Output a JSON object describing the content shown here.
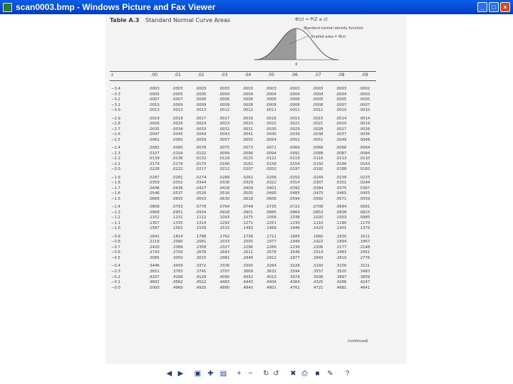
{
  "window": {
    "title": "scan0003.bmp - Windows Picture and Fax Viewer"
  },
  "table": {
    "number": "Table A.3",
    "caption": "Standard Normal Curve Areas",
    "formula": "Φ(z) = P(Z ≤ z)",
    "legend_density": "Standard normal density function",
    "legend_shaded": "Shaded area = Φ(z)",
    "axis_zero": "0",
    "header_z": "z",
    "columns": [
      ".00",
      ".01",
      ".02",
      ".03",
      ".04",
      ".05",
      ".06",
      ".07",
      ".08",
      ".09"
    ],
    "continued": "(continued)",
    "rows": [
      {
        "z": "−3.4",
        "v": [
          ".0003",
          ".0003",
          ".0003",
          ".0003",
          ".0003",
          ".0003",
          ".0003",
          ".0003",
          ".0003",
          ".0002"
        ]
      },
      {
        "z": "−3.3",
        "v": [
          ".0005",
          ".0005",
          ".0005",
          ".0004",
          ".0004",
          ".0004",
          ".0004",
          ".0004",
          ".0004",
          ".0003"
        ]
      },
      {
        "z": "−3.2",
        "v": [
          ".0007",
          ".0007",
          ".0006",
          ".0006",
          ".0006",
          ".0006",
          ".0006",
          ".0005",
          ".0005",
          ".0005"
        ]
      },
      {
        "z": "−3.1",
        "v": [
          ".0010",
          ".0009",
          ".0009",
          ".0009",
          ".0008",
          ".0008",
          ".0008",
          ".0008",
          ".0007",
          ".0007"
        ]
      },
      {
        "z": "−3.0",
        "v": [
          ".0013",
          ".0013",
          ".0013",
          ".0012",
          ".0012",
          ".0011",
          ".0011",
          ".0011",
          ".0010",
          ".0010"
        ]
      },
      {
        "z": "−2.9",
        "v": [
          ".0019",
          ".0018",
          ".0017",
          ".0017",
          ".0016",
          ".0016",
          ".0015",
          ".0015",
          ".0014",
          ".0014"
        ]
      },
      {
        "z": "−2.8",
        "v": [
          ".0026",
          ".0025",
          ".0024",
          ".0023",
          ".0023",
          ".0022",
          ".0021",
          ".0021",
          ".0020",
          ".0019"
        ]
      },
      {
        "z": "−2.7",
        "v": [
          ".0035",
          ".0034",
          ".0033",
          ".0032",
          ".0031",
          ".0030",
          ".0029",
          ".0028",
          ".0027",
          ".0026"
        ]
      },
      {
        "z": "−2.6",
        "v": [
          ".0047",
          ".0045",
          ".0044",
          ".0043",
          ".0041",
          ".0040",
          ".0039",
          ".0038",
          ".0037",
          ".0036"
        ]
      },
      {
        "z": "−2.5",
        "v": [
          ".0062",
          ".0060",
          ".0059",
          ".0057",
          ".0055",
          ".0054",
          ".0052",
          ".0051",
          ".0049",
          ".0048"
        ]
      },
      {
        "z": "−2.4",
        "v": [
          ".0082",
          ".0080",
          ".0078",
          ".0075",
          ".0073",
          ".0071",
          ".0069",
          ".0068",
          ".0066",
          ".0064"
        ]
      },
      {
        "z": "−2.3",
        "v": [
          ".0107",
          ".0104",
          ".0102",
          ".0099",
          ".0096",
          ".0094",
          ".0091",
          ".0089",
          ".0087",
          ".0084"
        ]
      },
      {
        "z": "−2.2",
        "v": [
          ".0139",
          ".0136",
          ".0132",
          ".0129",
          ".0125",
          ".0122",
          ".0119",
          ".0116",
          ".0113",
          ".0110"
        ]
      },
      {
        "z": "−2.1",
        "v": [
          ".0179",
          ".0174",
          ".0170",
          ".0166",
          ".0162",
          ".0158",
          ".0154",
          ".0150",
          ".0146",
          ".0143"
        ]
      },
      {
        "z": "−2.0",
        "v": [
          ".0228",
          ".0222",
          ".0217",
          ".0212",
          ".0207",
          ".0202",
          ".0197",
          ".0192",
          ".0188",
          ".0183"
        ]
      },
      {
        "z": "−1.9",
        "v": [
          ".0287",
          ".0281",
          ".0274",
          ".0268",
          ".0262",
          ".0256",
          ".0250",
          ".0244",
          ".0239",
          ".0233"
        ]
      },
      {
        "z": "−1.8",
        "v": [
          ".0359",
          ".0352",
          ".0344",
          ".0336",
          ".0329",
          ".0322",
          ".0314",
          ".0307",
          ".0301",
          ".0294"
        ]
      },
      {
        "z": "−1.7",
        "v": [
          ".0446",
          ".0436",
          ".0427",
          ".0418",
          ".0409",
          ".0401",
          ".0392",
          ".0384",
          ".0375",
          ".0367"
        ]
      },
      {
        "z": "−1.6",
        "v": [
          ".0548",
          ".0537",
          ".0526",
          ".0516",
          ".0505",
          ".0495",
          ".0485",
          ".0475",
          ".0465",
          ".0455"
        ]
      },
      {
        "z": "−1.5",
        "v": [
          ".0668",
          ".0655",
          ".0643",
          ".0630",
          ".0618",
          ".0606",
          ".0594",
          ".0582",
          ".0571",
          ".0559"
        ]
      },
      {
        "z": "−1.4",
        "v": [
          ".0808",
          ".0793",
          ".0778",
          ".0764",
          ".0749",
          ".0735",
          ".0722",
          ".0708",
          ".0694",
          ".0681"
        ]
      },
      {
        "z": "−1.3",
        "v": [
          ".0968",
          ".0951",
          ".0934",
          ".0918",
          ".0901",
          ".0885",
          ".0869",
          ".0853",
          ".0838",
          ".0823"
        ]
      },
      {
        "z": "−1.2",
        "v": [
          ".1151",
          ".1131",
          ".1112",
          ".1093",
          ".1075",
          ".1056",
          ".1038",
          ".1020",
          ".1003",
          ".0985"
        ]
      },
      {
        "z": "−1.1",
        "v": [
          ".1357",
          ".1335",
          ".1314",
          ".1292",
          ".1271",
          ".1251",
          ".1230",
          ".1210",
          ".1190",
          ".1170"
        ]
      },
      {
        "z": "−1.0",
        "v": [
          ".1587",
          ".1562",
          ".1539",
          ".1515",
          ".1492",
          ".1469",
          ".1446",
          ".1423",
          ".1401",
          ".1379"
        ]
      },
      {
        "z": "−0.9",
        "v": [
          ".1841",
          ".1814",
          ".1788",
          ".1762",
          ".1736",
          ".1711",
          ".1685",
          ".1660",
          ".1635",
          ".1611"
        ]
      },
      {
        "z": "−0.8",
        "v": [
          ".2119",
          ".2090",
          ".2061",
          ".2033",
          ".2005",
          ".1977",
          ".1949",
          ".1922",
          ".1894",
          ".1867"
        ]
      },
      {
        "z": "−0.7",
        "v": [
          ".2420",
          ".2389",
          ".2358",
          ".2327",
          ".2296",
          ".2266",
          ".2236",
          ".2206",
          ".2177",
          ".2148"
        ]
      },
      {
        "z": "−0.6",
        "v": [
          ".2743",
          ".2709",
          ".2676",
          ".2643",
          ".2611",
          ".2578",
          ".2546",
          ".2514",
          ".2483",
          ".2451"
        ]
      },
      {
        "z": "−0.5",
        "v": [
          ".3085",
          ".3050",
          ".3015",
          ".2981",
          ".2946",
          ".2912",
          ".2877",
          ".2843",
          ".2810",
          ".2776"
        ]
      },
      {
        "z": "−0.4",
        "v": [
          ".3446",
          ".3409",
          ".3372",
          ".3336",
          ".3300",
          ".3264",
          ".3228",
          ".3192",
          ".3156",
          ".3121"
        ]
      },
      {
        "z": "−0.3",
        "v": [
          ".3821",
          ".3783",
          ".3745",
          ".3707",
          ".3669",
          ".3632",
          ".3594",
          ".3557",
          ".3520",
          ".3483"
        ]
      },
      {
        "z": "−0.2",
        "v": [
          ".4207",
          ".4168",
          ".4129",
          ".4090",
          ".4052",
          ".4013",
          ".3974",
          ".3936",
          ".3897",
          ".3859"
        ]
      },
      {
        "z": "−0.1",
        "v": [
          ".4602",
          ".4562",
          ".4522",
          ".4483",
          ".4443",
          ".4404",
          ".4364",
          ".4325",
          ".4286",
          ".4247"
        ]
      },
      {
        "z": "−0.0",
        "v": [
          ".5000",
          ".4960",
          ".4920",
          ".4880",
          ".4840",
          ".4801",
          ".4761",
          ".4721",
          ".4681",
          ".4641"
        ]
      }
    ]
  },
  "toolbar": {
    "buttons": [
      {
        "name": "previous-image-button",
        "glyph": "◀"
      },
      {
        "name": "next-image-button",
        "glyph": "▶"
      },
      {
        "name": "best-fit-button",
        "glyph": "▣"
      },
      {
        "name": "actual-size-button",
        "glyph": "✚"
      },
      {
        "name": "slideshow-button",
        "glyph": "▤"
      },
      {
        "name": "zoom-in-button",
        "glyph": "+"
      },
      {
        "name": "zoom-out-button",
        "glyph": "−"
      },
      {
        "name": "rotate-clockwise-button",
        "glyph": "↻"
      },
      {
        "name": "rotate-counterclockwise-button",
        "glyph": "↺"
      },
      {
        "name": "delete-button",
        "glyph": "✖"
      },
      {
        "name": "print-button",
        "glyph": "⎙"
      },
      {
        "name": "save-button",
        "glyph": "■"
      },
      {
        "name": "edit-button",
        "glyph": "✎"
      },
      {
        "name": "help-button",
        "glyph": "?"
      }
    ]
  }
}
